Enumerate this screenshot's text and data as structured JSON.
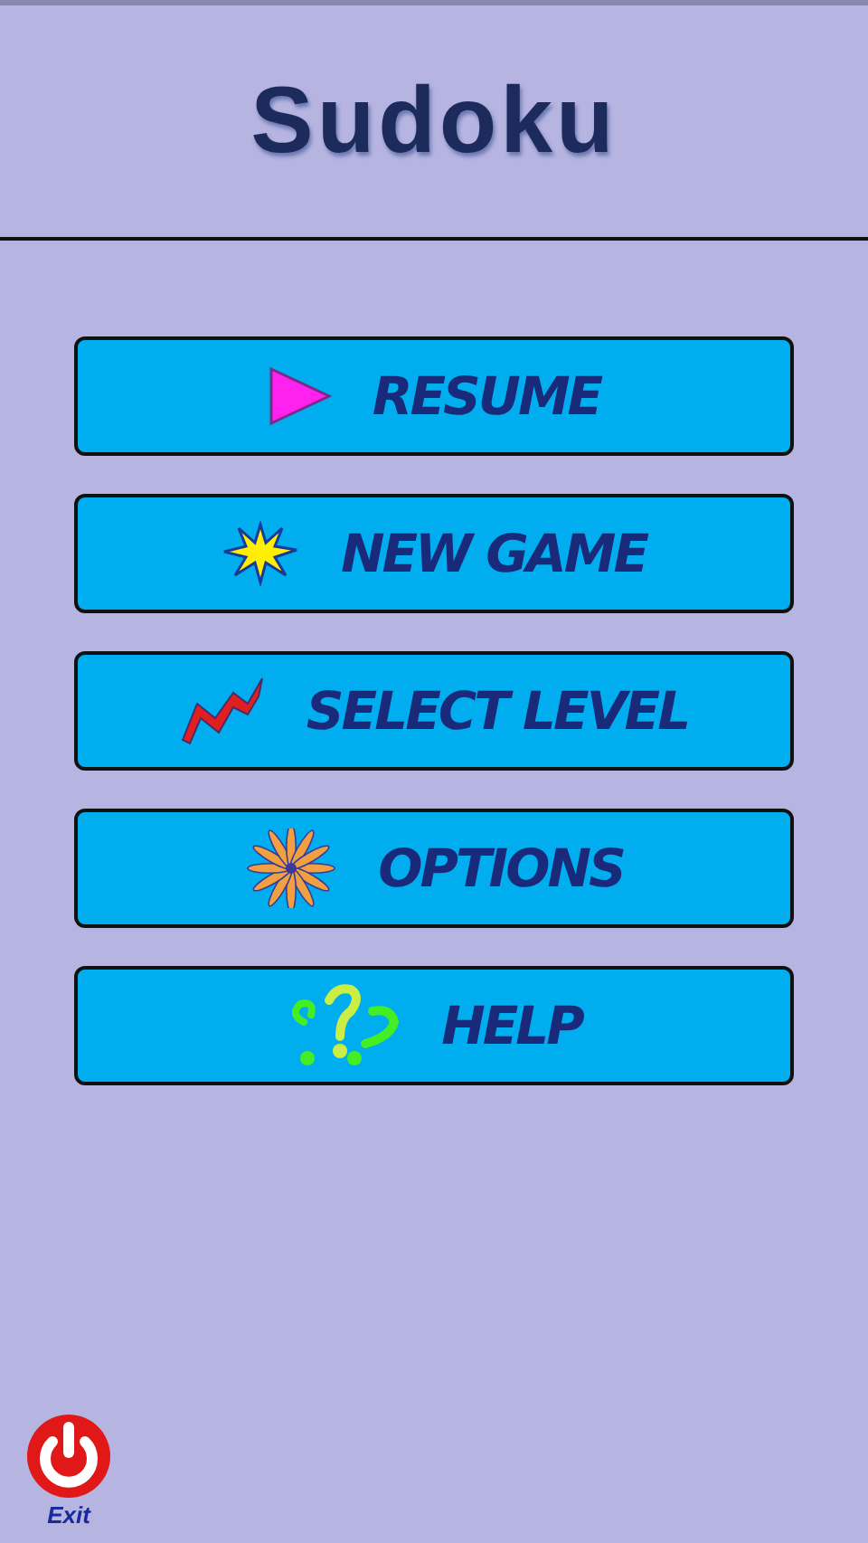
{
  "title": "Sudoku",
  "menu": [
    {
      "kind": "play",
      "label": "RESUME"
    },
    {
      "kind": "burst",
      "label": "NEW GAME"
    },
    {
      "kind": "zigzag",
      "label": "SELECT LEVEL"
    },
    {
      "kind": "flower",
      "label": "OPTIONS"
    },
    {
      "kind": "question",
      "label": "HELP"
    }
  ],
  "exit": {
    "label": "Exit"
  }
}
